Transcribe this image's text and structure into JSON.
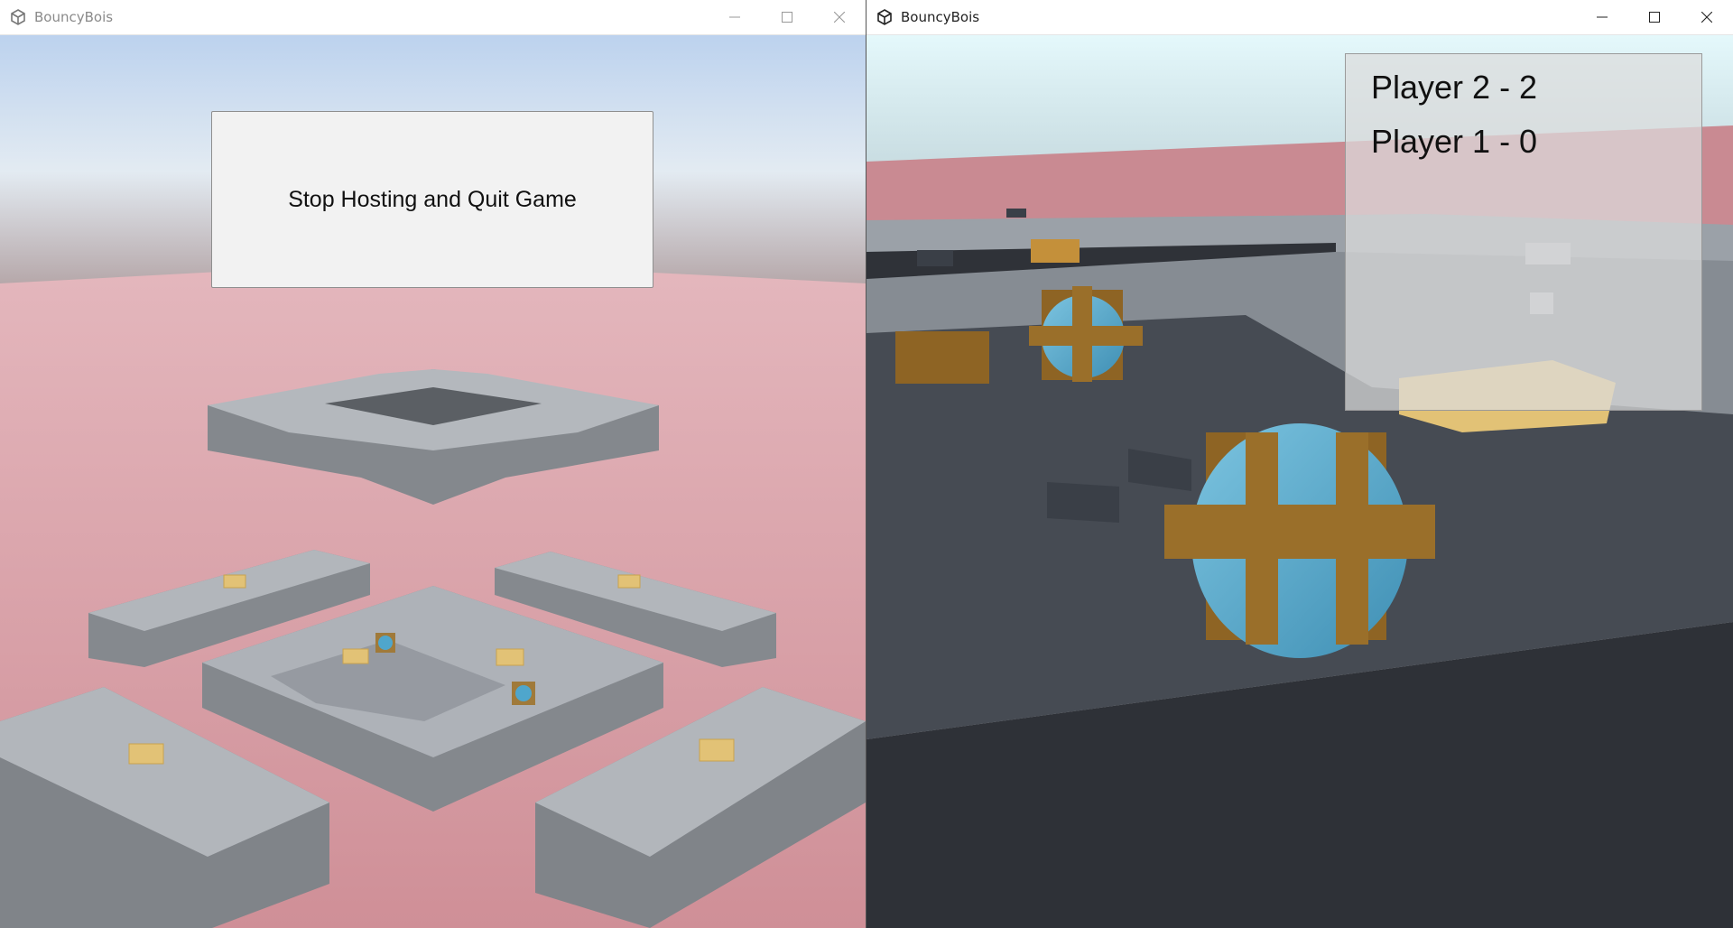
{
  "left_window": {
    "title": "BouncyBois",
    "controls": [
      "minimize",
      "maximize",
      "close"
    ],
    "stop_button_label": "Stop Hosting and Quit Game"
  },
  "right_window": {
    "title": "BouncyBois",
    "controls": [
      "minimize",
      "maximize",
      "close"
    ],
    "scoreboard": [
      {
        "label": "Player 2 - 2"
      },
      {
        "label": "Player 1 - 0"
      }
    ]
  },
  "colors": {
    "sky_top": "#c3d6ee",
    "ground_pink": "#d79aa2",
    "platform_gray": "#a8adb2",
    "box_yellow": "#e2c276",
    "crate_brown": "#8e6424",
    "ball_blue": "#4fa6cc"
  }
}
